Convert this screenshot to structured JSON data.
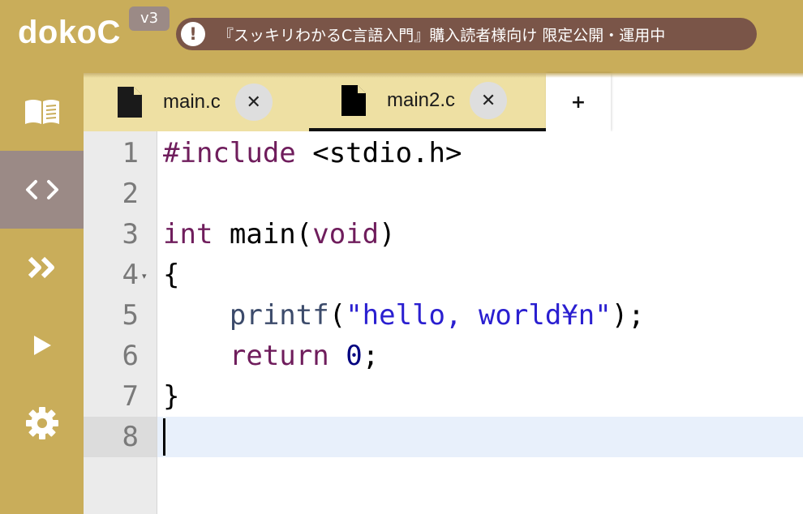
{
  "header": {
    "brand": "dokoC",
    "version": "v3",
    "notice_icon": "!",
    "notice": "『スッキリわかるC言語入門』購入読者様向け 限定公開・運用中"
  },
  "sidebar": {
    "items": [
      {
        "icon": "book-icon"
      },
      {
        "icon": "code-icon"
      },
      {
        "icon": "double-chevron-icon"
      },
      {
        "icon": "play-icon"
      },
      {
        "icon": "gear-icon"
      }
    ],
    "active_index": 1
  },
  "tabs": [
    {
      "label": "main.c",
      "close": "✕",
      "active": false
    },
    {
      "label": "main2.c",
      "close": "✕",
      "active": true
    }
  ],
  "add_tab_label": "+",
  "editor": {
    "line_numbers": [
      "1",
      "2",
      "3",
      "4",
      "5",
      "6",
      "7",
      "8"
    ],
    "lines": [
      "#include <stdio.h>",
      "",
      "int main(void)",
      "{",
      "    printf(\"hello, world¥n\");",
      "    return 0;",
      "}",
      ""
    ],
    "tokens": {
      "l1_directive": "#include",
      "l1_rest": " <stdio.h>",
      "l3_int": "int",
      "l3_main": " main(",
      "l3_void": "void",
      "l3_close": ")",
      "l4": "{",
      "l5_indent": "    ",
      "l5_fn": "printf",
      "l5_open": "(",
      "l5_str": "\"hello, world¥n\"",
      "l5_close": ");",
      "l6_indent": "    ",
      "l6_kw": "return",
      "l6_sp": " ",
      "l6_num": "0",
      "l6_semi": ";",
      "l7": "}"
    },
    "active_line": 8
  },
  "colors": {
    "header_bg": "#c9ad5a",
    "notice_bg": "#7a5548",
    "tab_bg": "#eee0a3",
    "active_line": "#e8f0fb",
    "keyword": "#6f1d5c",
    "string": "#2a1fd0",
    "number": "#00007f"
  }
}
